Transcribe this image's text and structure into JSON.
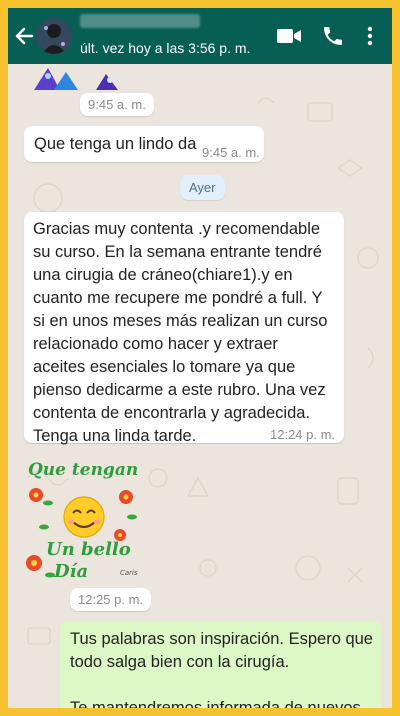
{
  "header": {
    "back_icon": "arrow-left-icon",
    "status": "últ. vez hoy a las 3:56 p. m.",
    "icons": [
      "video-call-icon",
      "phone-icon",
      "more-vert-icon"
    ]
  },
  "colors": {
    "header_bg": "#075e54",
    "chat_bg": "#ece5dd",
    "incoming_bubble": "#ffffff",
    "outgoing_bubble": "#dcf8c6",
    "frame_border": "#f6c22e"
  },
  "messages": {
    "image_time": "9:45 a. m.",
    "msg1": {
      "text": "Que tenga un lindo da",
      "time": "9:45 a. m."
    },
    "date_separator": "Ayer",
    "msg2": {
      "text": "Gracias  muy contenta .y recomendable su curso. En la semana entrante tendré una cirugia de cráneo(chiare1).y en cuanto me recupere me pondré a full. Y si en unos meses más realizan un curso relacionado como hacer y extraer aceites esenciales lo tomare ya que pienso dedicarme a este rubro. Una vez contenta de encontrarla y agradecida.  Tenga una linda tarde.",
      "time": "12:24 p. m."
    },
    "sticker": {
      "line1": "Que tengan",
      "line2": "Un bello",
      "line3": "Día",
      "signature": "Caris",
      "time": "12:25 p. m."
    },
    "msg3": {
      "para1": "Tus palabras son inspiración.  Espero que todo salga bien con la cirugía.",
      "para2": "Te mantendremos informada de nuevos"
    }
  }
}
